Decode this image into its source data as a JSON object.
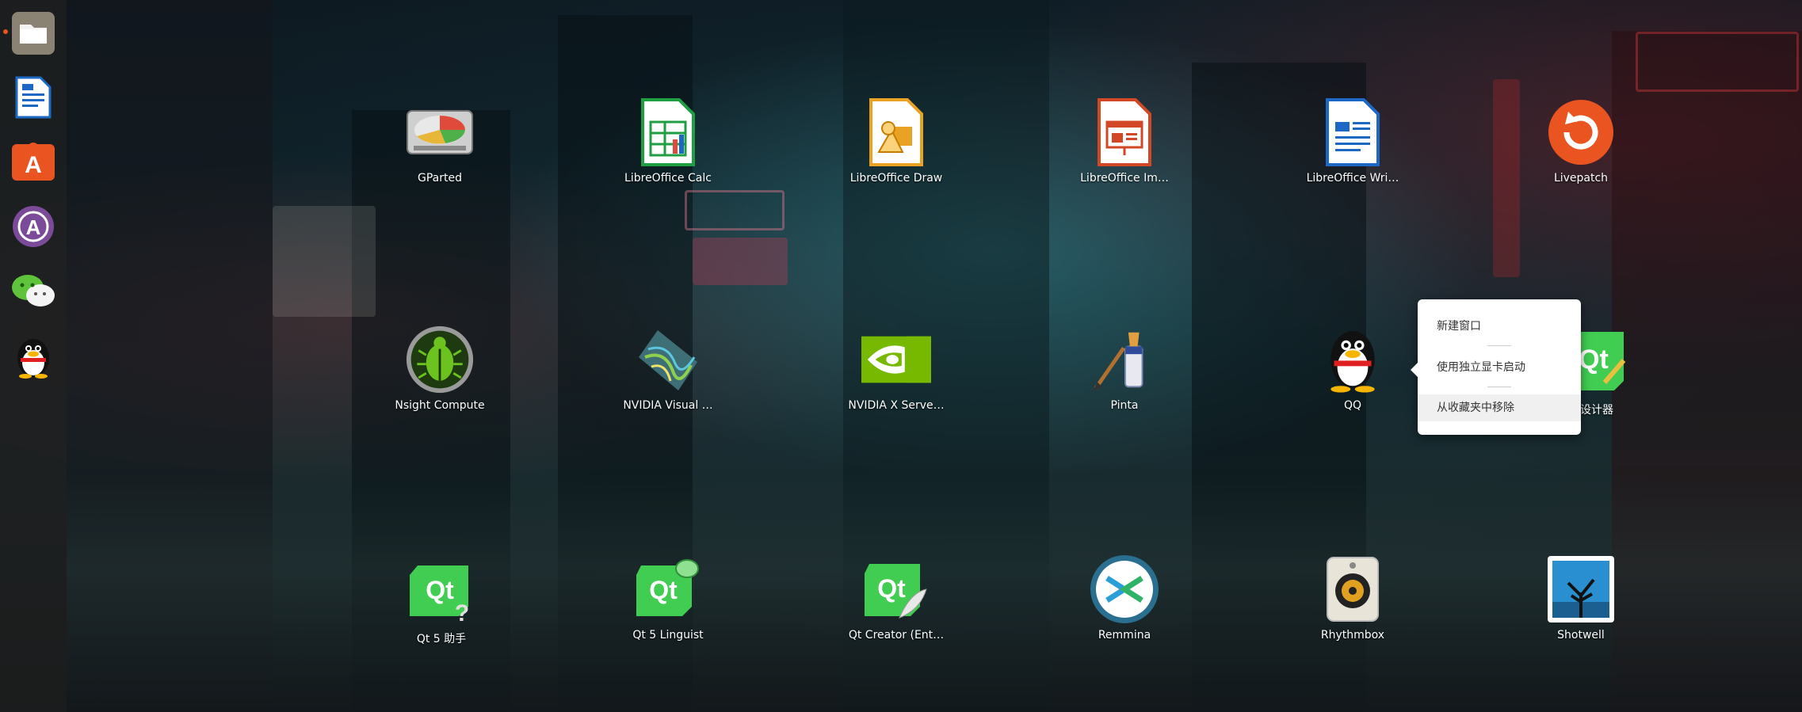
{
  "dock": {
    "items": [
      {
        "name": "files",
        "icon": "folder-icon",
        "running": true
      },
      {
        "name": "libreoffice-writer",
        "icon": "writer-document-icon",
        "running": false
      },
      {
        "name": "ubuntu-software",
        "icon": "shopping-bag-icon",
        "running": false
      },
      {
        "name": "dock-app-a",
        "icon": "circle-a-icon",
        "running": false
      },
      {
        "name": "wechat",
        "icon": "wechat-icon",
        "running": false
      },
      {
        "name": "qq",
        "icon": "penguin-icon",
        "running": false
      }
    ]
  },
  "apps": [
    {
      "label": "GParted",
      "icon": "disk-partition-icon"
    },
    {
      "label": "LibreOffice Calc",
      "icon": "spreadsheet-icon"
    },
    {
      "label": "LibreOffice Draw",
      "icon": "drawing-icon"
    },
    {
      "label": "LibreOffice Im…",
      "icon": "presentation-icon"
    },
    {
      "label": "LibreOffice Wri…",
      "icon": "writer-document-icon"
    },
    {
      "label": "Livepatch",
      "icon": "livepatch-icon"
    },
    {
      "label": "Nsight Compute",
      "icon": "beetle-icon"
    },
    {
      "label": "NVIDIA Visual …",
      "icon": "visual-profiler-icon"
    },
    {
      "label": "NVIDIA X Serve…",
      "icon": "nvidia-eye-icon"
    },
    {
      "label": "Pinta",
      "icon": "paint-brush-icon"
    },
    {
      "label": "QQ",
      "icon": "penguin-icon"
    },
    {
      "label": "设计器",
      "icon": "qt-designer-icon"
    },
    {
      "label": "Qt 5 助手",
      "icon": "qt-assistant-icon"
    },
    {
      "label": "Qt 5 Linguist",
      "icon": "qt-linguist-icon"
    },
    {
      "label": "Qt Creator (Ent…",
      "icon": "qt-creator-icon"
    },
    {
      "label": "Remmina",
      "icon": "remmina-icon"
    },
    {
      "label": "Rhythmbox",
      "icon": "speaker-icon"
    },
    {
      "label": "Shotwell",
      "icon": "photo-tree-icon"
    }
  ],
  "context_menu": {
    "items": [
      {
        "label": "新建窗口",
        "highlighted": false
      },
      {
        "label": "使用独立显卡启动",
        "highlighted": false
      },
      {
        "label": "从收藏夹中移除",
        "highlighted": true
      }
    ]
  },
  "colors": {
    "accent": "#e95420",
    "qt_green": "#41cd52",
    "libreoffice_calc": "#1f9e43",
    "libreoffice_draw": "#e9a223",
    "libreoffice_impress": "#d24726",
    "libreoffice_writer": "#1d68c4"
  }
}
